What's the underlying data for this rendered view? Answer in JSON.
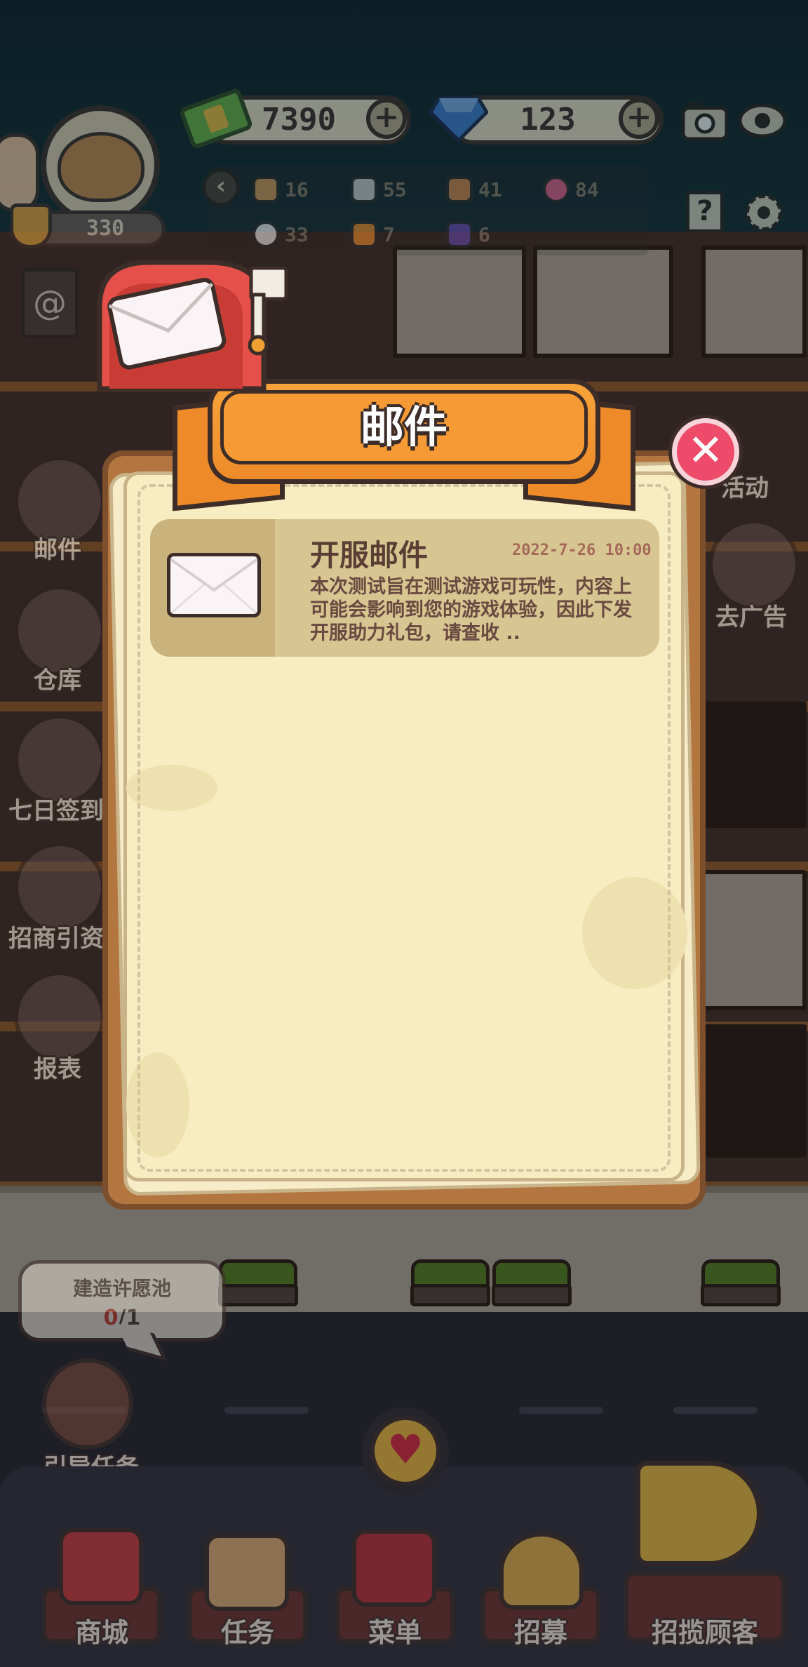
{
  "hud": {
    "cash": "7390",
    "gems": "123",
    "trophies": "330",
    "resources": [
      {
        "icon": "wood-icon",
        "value": "16"
      },
      {
        "icon": "stone-icon",
        "value": "55"
      },
      {
        "icon": "brick-icon",
        "value": "41"
      },
      {
        "icon": "flower-icon",
        "value": "84"
      },
      {
        "icon": "cotton-icon",
        "value": "33"
      },
      {
        "icon": "carrot-icon",
        "value": "7"
      },
      {
        "icon": "crystal-icon",
        "value": "6"
      }
    ],
    "help_label": "?"
  },
  "left_menu": [
    {
      "id": "mail",
      "label": "邮件"
    },
    {
      "id": "warehouse",
      "label": "仓库"
    },
    {
      "id": "checkin",
      "label": "七日签到"
    },
    {
      "id": "investment",
      "label": "招商引资"
    },
    {
      "id": "report",
      "label": "报表"
    }
  ],
  "right_menu": [
    {
      "id": "events",
      "label": "活动"
    },
    {
      "id": "ads",
      "label": "去广告"
    }
  ],
  "mail_dialog": {
    "title": "邮件",
    "close_symbol": "✕",
    "mails": [
      {
        "subject": "开服邮件",
        "date": "2022-7-26 10:00",
        "preview": "本次测试旨在测试游戏可玩性，内容上可能会影响到您的游戏体验，因此下发开服助力礼包，请查收 .."
      }
    ]
  },
  "wish_pool": {
    "title": "建造许愿池",
    "current": "0",
    "total": "/1"
  },
  "guide_task": {
    "label": "引导任务"
  },
  "bottom_tabs": [
    {
      "id": "shop",
      "label": "商城"
    },
    {
      "id": "tasks",
      "label": "任务"
    },
    {
      "id": "menu",
      "label": "菜单"
    },
    {
      "id": "recruit",
      "label": "招募"
    },
    {
      "id": "attract",
      "label": "招揽顾客"
    }
  ],
  "colors": {
    "accent_orange": "#ee8a2a",
    "close_red": "#ee4b6a",
    "paper": "#f7edc0",
    "outline": "#3d2d28"
  }
}
